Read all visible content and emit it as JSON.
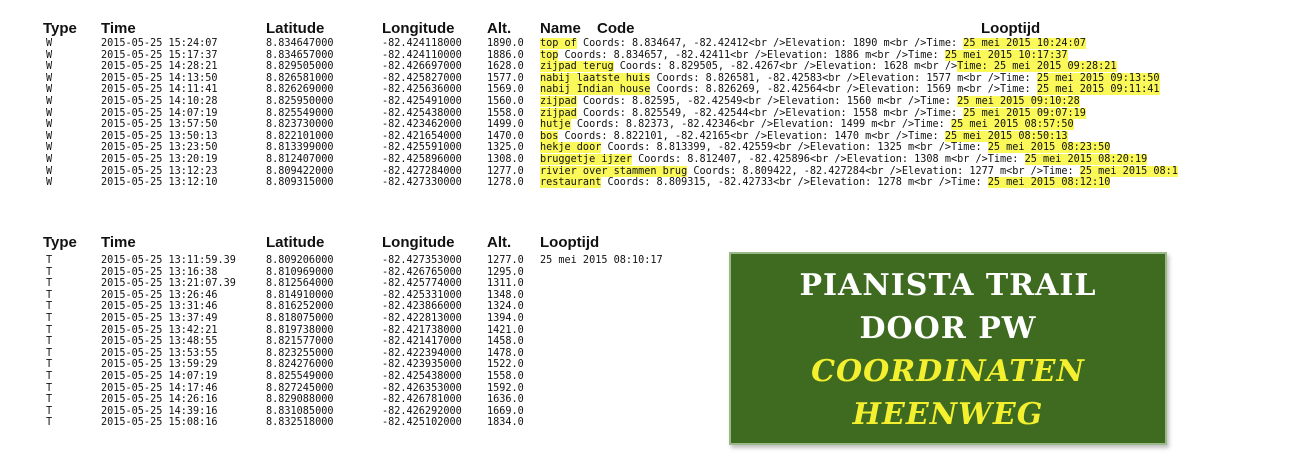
{
  "waypoints": {
    "headers": {
      "type": "Type",
      "time": "Time",
      "lat": "Latitude",
      "lon": "Longitude",
      "alt": "Alt.",
      "name": "Name",
      "code": "Code",
      "looptijd": "Looptijd"
    },
    "rows": [
      {
        "type": "W",
        "time": "2015-05-25 15:24:07",
        "lat": "8.834647000",
        "lon": "-82.424118000",
        "alt": "1890.0",
        "name": "top of",
        "code": "Coords: 8.834647, -82.42412<br />Elevation: 1890 m<br />Time: ",
        "timeval": "25 mei 2015 10:24:07"
      },
      {
        "type": "W",
        "time": "2015-05-25 15:17:37",
        "lat": "8.834657000",
        "lon": "-82.424110000",
        "alt": "1886.0",
        "name": "top",
        "code": "Coords: 8.834657, -82.42411<br />Elevation: 1886 m<br />Time: ",
        "timeval": "25 mei 2015 10:17:37"
      },
      {
        "type": "W",
        "time": "2015-05-25 14:28:21",
        "lat": "8.829505000",
        "lon": "-82.426697000",
        "alt": "1628.0",
        "name": "zijpad terug",
        "code": "Coords: 8.829505, -82.4267<br />Elevation: 1628 m<br />",
        "timeval": "Time: 25 mei 2015 09:28:21"
      },
      {
        "type": "W",
        "time": "2015-05-25 14:13:50",
        "lat": "8.826581000",
        "lon": "-82.425827000",
        "alt": "1577.0",
        "name": "nabij laatste huis",
        "code": "Coords: 8.826581, -82.42583<br />Elevation: 1577 m<br />Time: ",
        "timeval": "25 mei 2015 09:13:50"
      },
      {
        "type": "W",
        "time": "2015-05-25 14:11:41",
        "lat": "8.826269000",
        "lon": "-82.425636000",
        "alt": "1569.0",
        "name": "nabij Indian house",
        "code": "Coords: 8.826269, -82.42564<br />Elevation: 1569 m<br />Time: ",
        "timeval": "25 mei 2015 09:11:41"
      },
      {
        "type": "W",
        "time": "2015-05-25 14:10:28",
        "lat": "8.825950000",
        "lon": "-82.425491000",
        "alt": "1560.0",
        "name": "zijpad",
        "code": "Coords: 8.82595, -82.42549<br />Elevation: 1560 m<br />Time: ",
        "timeval": "25 mei 2015 09:10:28"
      },
      {
        "type": "W",
        "time": "2015-05-25 14:07:19",
        "lat": "8.825549000",
        "lon": "-82.425438000",
        "alt": "1558.0",
        "name": "zijpad",
        "code": "Coords: 8.825549, -82.42544<br />Elevation: 1558 m<br />Time: ",
        "timeval": "25 mei 2015 09:07:19"
      },
      {
        "type": "W",
        "time": "2015-05-25 13:57:50",
        "lat": "8.823730000",
        "lon": "-82.423462000",
        "alt": "1499.0",
        "name": "hutje",
        "code": "Coords: 8.82373, -82.42346<br />Elevation: 1499 m<br />Time: ",
        "timeval": "25 mei 2015 08:57:50"
      },
      {
        "type": "W",
        "time": "2015-05-25 13:50:13",
        "lat": "8.822101000",
        "lon": "-82.421654000",
        "alt": "1470.0",
        "name": "bos",
        "code": "Coords: 8.822101, -82.42165<br />Elevation: 1470 m<br />Time: ",
        "timeval": "25 mei 2015 08:50:13"
      },
      {
        "type": "W",
        "time": "2015-05-25 13:23:50",
        "lat": "8.813399000",
        "lon": "-82.425591000",
        "alt": "1325.0",
        "name": "hekje door",
        "code": "Coords: 8.813399, -82.42559<br />Elevation: 1325 m<br />Time: ",
        "timeval": "25 mei 2015 08:23:50"
      },
      {
        "type": "W",
        "time": "2015-05-25 13:20:19",
        "lat": "8.812407000",
        "lon": "-82.425896000",
        "alt": "1308.0",
        "name": "bruggetje ijzer",
        "code": "Coords: 8.812407, -82.425896<br />Elevation: 1308 m<br />Time: ",
        "timeval": "25 mei 2015 08:20:19"
      },
      {
        "type": "W",
        "time": "2015-05-25 13:12:23",
        "lat": "8.809422000",
        "lon": "-82.427284000",
        "alt": "1277.0",
        "name": "rivier over stammen brug",
        "code": "Coords: 8.809422, -82.427284<br />Elevation: 1277 m<br />Time: ",
        "timeval": "25 mei 2015 08:1"
      },
      {
        "type": "W",
        "time": "2015-05-25 13:12:10",
        "lat": "8.809315000",
        "lon": "-82.427330000",
        "alt": "1278.0",
        "name": "restaurant",
        "code": "Coords: 8.809315, -82.42733<br />Elevation: 1278 m<br />Time: ",
        "timeval": "25 mei 2015 08:12:10"
      }
    ]
  },
  "track": {
    "headers": {
      "type": "Type",
      "time": "Time",
      "lat": "Latitude",
      "lon": "Longitude",
      "alt": "Alt.",
      "looptijd": "Looptijd"
    },
    "looptijd_value": "25 mei 2015 08:10:17",
    "rows": [
      {
        "type": "T",
        "time": "2015-05-25 13:11:59.39",
        "lat": "8.809206000",
        "lon": "-82.427353000",
        "alt": "1277.0"
      },
      {
        "type": "T",
        "time": "2015-05-25 13:16:38",
        "lat": "8.810969000",
        "lon": "-82.426765000",
        "alt": "1295.0"
      },
      {
        "type": "T",
        "time": "2015-05-25 13:21:07.39",
        "lat": "8.812564000",
        "lon": "-82.425774000",
        "alt": "1311.0"
      },
      {
        "type": "T",
        "time": "2015-05-25 13:26:46",
        "lat": "8.814910000",
        "lon": "-82.425331000",
        "alt": "1348.0"
      },
      {
        "type": "T",
        "time": "2015-05-25 13:31:46",
        "lat": "8.816252000",
        "lon": "-82.423866000",
        "alt": "1324.0"
      },
      {
        "type": "T",
        "time": "2015-05-25 13:37:49",
        "lat": "8.818075000",
        "lon": "-82.422813000",
        "alt": "1394.0"
      },
      {
        "type": "T",
        "time": "2015-05-25 13:42:21",
        "lat": "8.819738000",
        "lon": "-82.421738000",
        "alt": "1421.0"
      },
      {
        "type": "T",
        "time": "2015-05-25 13:48:55",
        "lat": "8.821577000",
        "lon": "-82.421417000",
        "alt": "1458.0"
      },
      {
        "type": "T",
        "time": "2015-05-25 13:53:55",
        "lat": "8.823255000",
        "lon": "-82.422394000",
        "alt": "1478.0"
      },
      {
        "type": "T",
        "time": "2015-05-25 13:59:29",
        "lat": "8.824276000",
        "lon": "-82.423935000",
        "alt": "1522.0"
      },
      {
        "type": "T",
        "time": "2015-05-25 14:07:19",
        "lat": "8.825549000",
        "lon": "-82.425438000",
        "alt": "1558.0"
      },
      {
        "type": "T",
        "time": "2015-05-25 14:17:46",
        "lat": "8.827245000",
        "lon": "-82.426353000",
        "alt": "1592.0"
      },
      {
        "type": "T",
        "time": "2015-05-25 14:26:16",
        "lat": "8.829088000",
        "lon": "-82.426781000",
        "alt": "1636.0"
      },
      {
        "type": "T",
        "time": "2015-05-25 14:39:16",
        "lat": "8.831085000",
        "lon": "-82.426292000",
        "alt": "1669.0"
      },
      {
        "type": "T",
        "time": "2015-05-25 15:08:16",
        "lat": "8.832518000",
        "lon": "-82.425102000",
        "alt": "1834.0"
      }
    ]
  },
  "banner": {
    "line1": "PIANISTA TRAIL",
    "line2": "DOOR PW",
    "line3": "COORDINATEN",
    "line4": "HEENWEG",
    "colors": {
      "background": "#3e6b1f",
      "white_text": "#ffffff",
      "yellow_text": "#f4f030",
      "highlight": "#fbf95a"
    }
  }
}
